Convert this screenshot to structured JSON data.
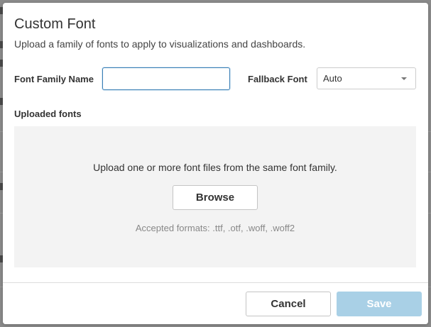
{
  "dialog": {
    "title": "Custom Font",
    "subtitle": "Upload a family of fonts to apply to visualizations and dashboards."
  },
  "form": {
    "font_family_label": "Font Family Name",
    "font_family_value": "",
    "fallback_label": "Fallback Font",
    "fallback_value": "Auto"
  },
  "uploaded": {
    "section_label": "Uploaded fonts",
    "instruction": "Upload one or more font files from the same font family.",
    "browse_label": "Browse",
    "accepted_formats": "Accepted formats: .ttf, .otf, .woff, .woff2"
  },
  "footer": {
    "cancel_label": "Cancel",
    "save_label": "Save",
    "save_enabled": false
  },
  "colors": {
    "save_disabled": "#a9d0e6",
    "input_focus_border": "#3a7fb5",
    "dropzone_bg": "#f3f3f3"
  }
}
